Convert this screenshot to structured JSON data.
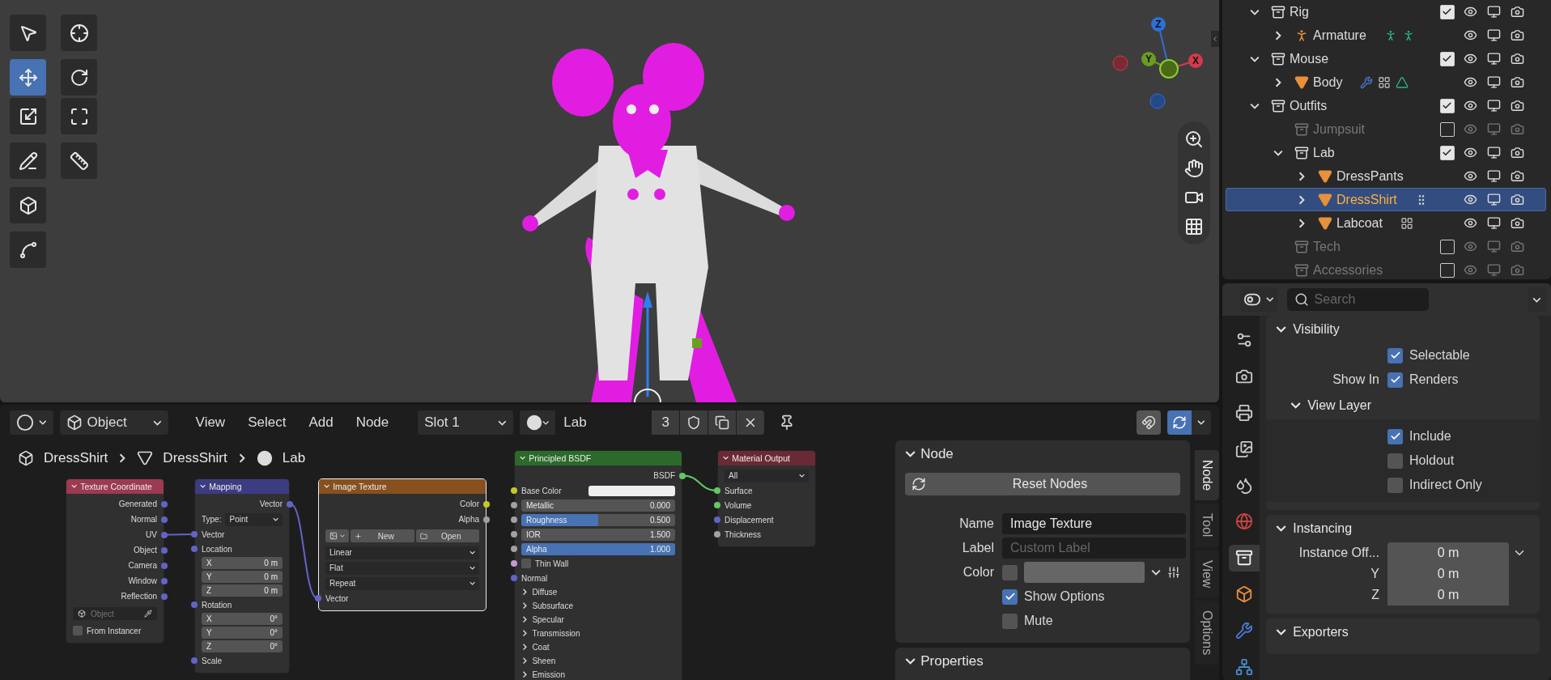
{
  "viewport": {
    "toolbar": [
      {
        "tools": [
          {
            "kind": "select_box",
            "selected": false
          },
          {
            "kind": "cursor",
            "selected": false
          }
        ]
      },
      {
        "tools": [
          {
            "kind": "move",
            "selected": true
          },
          {
            "kind": "rotate",
            "selected": false
          },
          {
            "kind": "scale",
            "selected": false
          },
          {
            "kind": "transform",
            "selected": false
          }
        ]
      },
      {
        "tools": [
          {
            "kind": "annotate",
            "selected": false
          },
          {
            "kind": "measure",
            "selected": false
          }
        ]
      },
      {
        "tools": [
          {
            "kind": "add_cube",
            "selected": false
          }
        ]
      },
      {
        "tools": [
          {
            "kind": "curve",
            "selected": false
          }
        ]
      }
    ],
    "gizmo": [
      {
        "label": "Z",
        "color": "#2f6fd6"
      },
      {
        "label": "Y",
        "color": "#6b9b1f"
      },
      {
        "label": "X",
        "color": "#d23b4b"
      }
    ]
  },
  "node_editor": {
    "header": {
      "mode": "Object",
      "menus": [
        "View",
        "Select",
        "Add",
        "Node"
      ],
      "slot": "Slot 1",
      "material": "Lab",
      "users": "3",
      "overlays_on": true
    },
    "breadcrumbs": [
      {
        "kind": "object",
        "label": "DressShirt"
      },
      {
        "kind": "mesh",
        "label": "DressShirt"
      },
      {
        "kind": "material",
        "label": "Lab"
      }
    ],
    "nodes": [
      {
        "title": "Texture Coordinate",
        "color": "#9c3a52",
        "selected": false,
        "rows": [
          {
            "kind": "output",
            "label": "Generated",
            "color": "#6363c7"
          },
          {
            "kind": "output",
            "label": "Normal",
            "color": "#6363c7"
          },
          {
            "kind": "output",
            "label": "UV",
            "color": "#6363c7"
          },
          {
            "kind": "output",
            "label": "Object",
            "color": "#6363c7"
          },
          {
            "kind": "output",
            "label": "Camera",
            "color": "#6363c7"
          },
          {
            "kind": "output",
            "label": "Window",
            "color": "#6363c7"
          },
          {
            "kind": "output",
            "label": "Reflection",
            "color": "#6363c7"
          },
          {
            "kind": "object_field",
            "placeholder": "Object"
          },
          {
            "kind": "checkbox",
            "label": "From Instancer",
            "checked": false
          }
        ]
      },
      {
        "title": "Mapping",
        "color": "#3c3c83",
        "selected": false,
        "rows": [
          {
            "kind": "output",
            "label": "Vector",
            "color": "#6363c7"
          },
          {
            "kind": "dropdown",
            "label": "Type:",
            "value": "Point"
          },
          {
            "kind": "input",
            "label": "Vector",
            "color": "#6363c7"
          },
          {
            "kind": "input",
            "label": "Location",
            "color": "#6363c7"
          },
          {
            "kind": "value",
            "label": "X",
            "value": "0 m"
          },
          {
            "kind": "value",
            "label": "Y",
            "value": "0 m"
          },
          {
            "kind": "value",
            "label": "Z",
            "value": "0 m"
          },
          {
            "kind": "input",
            "label": "Rotation",
            "color": "#6363c7"
          },
          {
            "kind": "value",
            "label": "X",
            "value": "0°"
          },
          {
            "kind": "value",
            "label": "Y",
            "value": "0°"
          },
          {
            "kind": "value",
            "label": "Z",
            "value": "0°"
          },
          {
            "kind": "input",
            "label": "Scale",
            "color": "#6363c7"
          }
        ]
      },
      {
        "title": "Image Texture",
        "color": "#87501f",
        "selected": true,
        "rows": [
          {
            "kind": "output",
            "label": "Color",
            "color": "#c7c729"
          },
          {
            "kind": "output",
            "label": "Alpha",
            "color": "#a1a1a1"
          },
          {
            "kind": "image_buttons",
            "new": "New",
            "open": "Open"
          },
          {
            "kind": "dropdown",
            "value": "Linear"
          },
          {
            "kind": "dropdown",
            "value": "Flat"
          },
          {
            "kind": "dropdown",
            "value": "Repeat"
          },
          {
            "kind": "input",
            "label": "Vector",
            "color": "#6363c7"
          }
        ]
      },
      {
        "title": "Principled BSDF",
        "color": "#2b6a2b",
        "selected": false,
        "rows": [
          {
            "kind": "output",
            "label": "BSDF",
            "color": "#63c763"
          },
          {
            "kind": "color",
            "label": "Base Color",
            "color": "#c7c729"
          },
          {
            "kind": "slider",
            "label": "Metallic",
            "value": "0.000",
            "level": 0,
            "color": "#a1a1a1"
          },
          {
            "kind": "slider",
            "label": "Roughness",
            "value": "0.500",
            "level": 0.5,
            "color": "#a1a1a1"
          },
          {
            "kind": "slider",
            "label": "IOR",
            "value": "1.500",
            "level": 0,
            "color": "#a1a1a1"
          },
          {
            "kind": "slider",
            "label": "Alpha",
            "value": "1.000",
            "level": 1,
            "color": "#a1a1a1"
          },
          {
            "kind": "checkbox",
            "label": "Thin Wall",
            "checked": false,
            "color": "#c59ad6"
          },
          {
            "kind": "input",
            "label": "Normal",
            "color": "#6363c7"
          },
          {
            "kind": "panel",
            "label": "Diffuse"
          },
          {
            "kind": "panel",
            "label": "Subsurface"
          },
          {
            "kind": "panel",
            "label": "Specular"
          },
          {
            "kind": "panel",
            "label": "Transmission"
          },
          {
            "kind": "panel",
            "label": "Coat"
          },
          {
            "kind": "panel",
            "label": "Sheen"
          },
          {
            "kind": "panel",
            "label": "Emission"
          }
        ]
      },
      {
        "title": "Material Output",
        "color": "#6a2a35",
        "selected": false,
        "rows": [
          {
            "kind": "dropdown",
            "value": "All"
          },
          {
            "kind": "input",
            "label": "Surface",
            "color": "#63c763"
          },
          {
            "kind": "input",
            "label": "Volume",
            "color": "#63c763"
          },
          {
            "kind": "input",
            "label": "Displacement",
            "color": "#6363c7"
          },
          {
            "kind": "input",
            "label": "Thickness",
            "color": "#a1a1a1"
          }
        ]
      }
    ],
    "sidebar": {
      "panels": [
        {
          "title": "Node",
          "expanded": true,
          "reset": "Reset Nodes",
          "fields": [
            {
              "label": "Name",
              "value": "Image Texture"
            },
            {
              "label": "Label",
              "placeholder": "Custom Label"
            }
          ],
          "color_row": {
            "label": "Color",
            "checked": false
          },
          "checkboxes": [
            {
              "label": "Show Options",
              "checked": true
            },
            {
              "label": "Mute",
              "checked": false
            }
          ]
        },
        {
          "title": "Properties",
          "expanded": true
        }
      ],
      "tabs": [
        {
          "label": "Node",
          "selected": true
        },
        {
          "label": "Tool",
          "selected": false
        },
        {
          "label": "View",
          "selected": false
        },
        {
          "label": "Options",
          "selected": false
        }
      ]
    }
  },
  "outliner": {
    "items": [
      {
        "kind": "collection",
        "label": "Rig",
        "checked": true,
        "expanded": true,
        "selected": false,
        "children": [
          {
            "kind": "armature",
            "label": "Armature",
            "expanded": false,
            "selected": false,
            "badges": [
              {
                "kind": "pose"
              },
              {
                "kind": "pose"
              }
            ]
          }
        ]
      },
      {
        "kind": "collection",
        "label": "Mouse",
        "checked": true,
        "expanded": true,
        "selected": false,
        "children": [
          {
            "kind": "mesh",
            "label": "Body",
            "expanded": false,
            "selected": false,
            "badges": [
              {
                "kind": "wrench"
              },
              {
                "kind": "groups"
              },
              {
                "kind": "mesh_data"
              }
            ]
          }
        ]
      },
      {
        "kind": "collection",
        "label": "Outfits",
        "checked": true,
        "expanded": true,
        "selected": false,
        "children": [
          {
            "kind": "collection",
            "label": "Jumpsuit",
            "checked": false,
            "selected": false
          },
          {
            "kind": "collection",
            "label": "Lab",
            "checked": true,
            "expanded": true,
            "selected": false,
            "children": [
              {
                "kind": "mesh",
                "label": "DressPants",
                "expanded": false,
                "selected": false
              },
              {
                "kind": "mesh",
                "label": "DressShirt",
                "expanded": false,
                "selected": true,
                "badges": [
                  {
                    "kind": "handle"
                  }
                ]
              },
              {
                "kind": "mesh",
                "label": "Labcoat",
                "expanded": false,
                "selected": false,
                "badges": [
                  {
                    "kind": "groups"
                  }
                ]
              }
            ]
          },
          {
            "kind": "collection",
            "label": "Tech",
            "checked": false,
            "selected": false
          },
          {
            "kind": "collection",
            "label": "Accessories",
            "checked": false,
            "selected": false
          }
        ]
      }
    ]
  },
  "properties": {
    "search": {
      "placeholder": "Search"
    },
    "tabs": [
      {
        "kind": "tool",
        "selected": false
      },
      {
        "kind": "render",
        "selected": false
      },
      {
        "kind": "output",
        "selected": false
      },
      {
        "kind": "view_layer",
        "selected": false
      },
      {
        "kind": "scene",
        "selected": false
      },
      {
        "kind": "world",
        "selected": false
      },
      {
        "kind": "collection",
        "selected": true
      },
      {
        "kind": "object",
        "selected": false
      },
      {
        "kind": "modifiers",
        "selected": false
      },
      {
        "kind": "particles",
        "selected": false
      }
    ],
    "panels": [
      {
        "title": "Visibility",
        "expanded": true,
        "rows": [
          {
            "kind": "checkbox",
            "text": "Selectable",
            "checked": true
          },
          {
            "kind": "checkbox",
            "label": "Show In",
            "text": "Renders",
            "checked": true
          }
        ],
        "subpanel": {
          "title": "View Layer",
          "expanded": true,
          "rows": [
            {
              "kind": "checkbox",
              "text": "Include",
              "checked": true
            },
            {
              "kind": "checkbox",
              "text": "Holdout",
              "checked": false
            },
            {
              "kind": "checkbox",
              "text": "Indirect Only",
              "checked": false
            }
          ]
        }
      },
      {
        "title": "Instancing",
        "expanded": true,
        "rows": [
          {
            "kind": "vector_head",
            "label": "Instance Off...",
            "value": "0 m"
          },
          {
            "kind": "vector",
            "label": "Y",
            "value": "0 m"
          },
          {
            "kind": "vector",
            "label": "Z",
            "value": "0 m"
          }
        ]
      },
      {
        "title": "Exporters",
        "expanded": true
      }
    ]
  }
}
